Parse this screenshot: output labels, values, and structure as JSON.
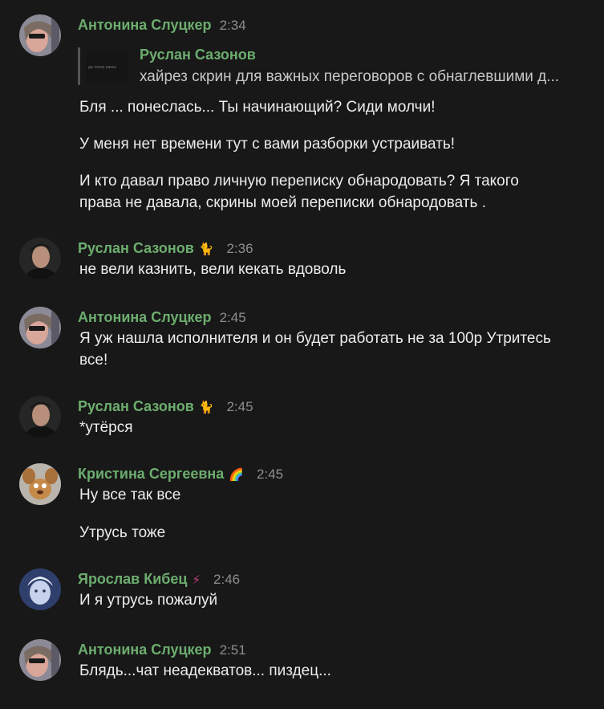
{
  "messages": [
    {
      "author": "Антонина Слуцкер",
      "time": "2:34",
      "reply": {
        "author": "Руслан Сазонов",
        "text": "хайрез скрин для важных переговоров с обнаглевшими д...",
        "thumb_text": "да тонне шины"
      },
      "lines": [
        "Бля ... понеслась... Ты начинающий? Сиди молчи!",
        "У меня нет времени тут с вами разборки устраивать!",
        "И кто давал право личную переписку обнародовать? Я такого",
        "права не давала, скрины моей переписки обнародовать ."
      ]
    },
    {
      "author": "Руслан Сазонов",
      "emoji": "🐈",
      "time": "2:36",
      "lines": [
        "не вели казнить, вели кекать вдоволь"
      ]
    },
    {
      "author": "Антонина Слуцкер",
      "time": "2:45",
      "lines": [
        "Я уж нашла исполнителя и он будет работать не за 100р Утритесь",
        "все!"
      ]
    },
    {
      "author": "Руслан Сазонов",
      "emoji": "🐈",
      "time": "2:45",
      "lines": [
        "*утёрся"
      ]
    },
    {
      "author": "Кристина Сергеевна",
      "emoji": "🌈",
      "time": "2:45",
      "lines": [
        "Ну все так все",
        "Утрусь тоже"
      ]
    },
    {
      "author": "Ярослав Кибец",
      "emoji": "⚡",
      "time": "2:46",
      "lines": [
        "И я утрусь пожалуй"
      ]
    },
    {
      "author": "Антонина Слуцкер",
      "time": "2:51",
      "lines": [
        "Блядь...чат неадекватов... пиздец..."
      ]
    }
  ],
  "colors": {
    "background": "#181818",
    "author_name": "#6cad6e",
    "timestamp": "#8e8e8e",
    "message_text": "#ececec"
  }
}
